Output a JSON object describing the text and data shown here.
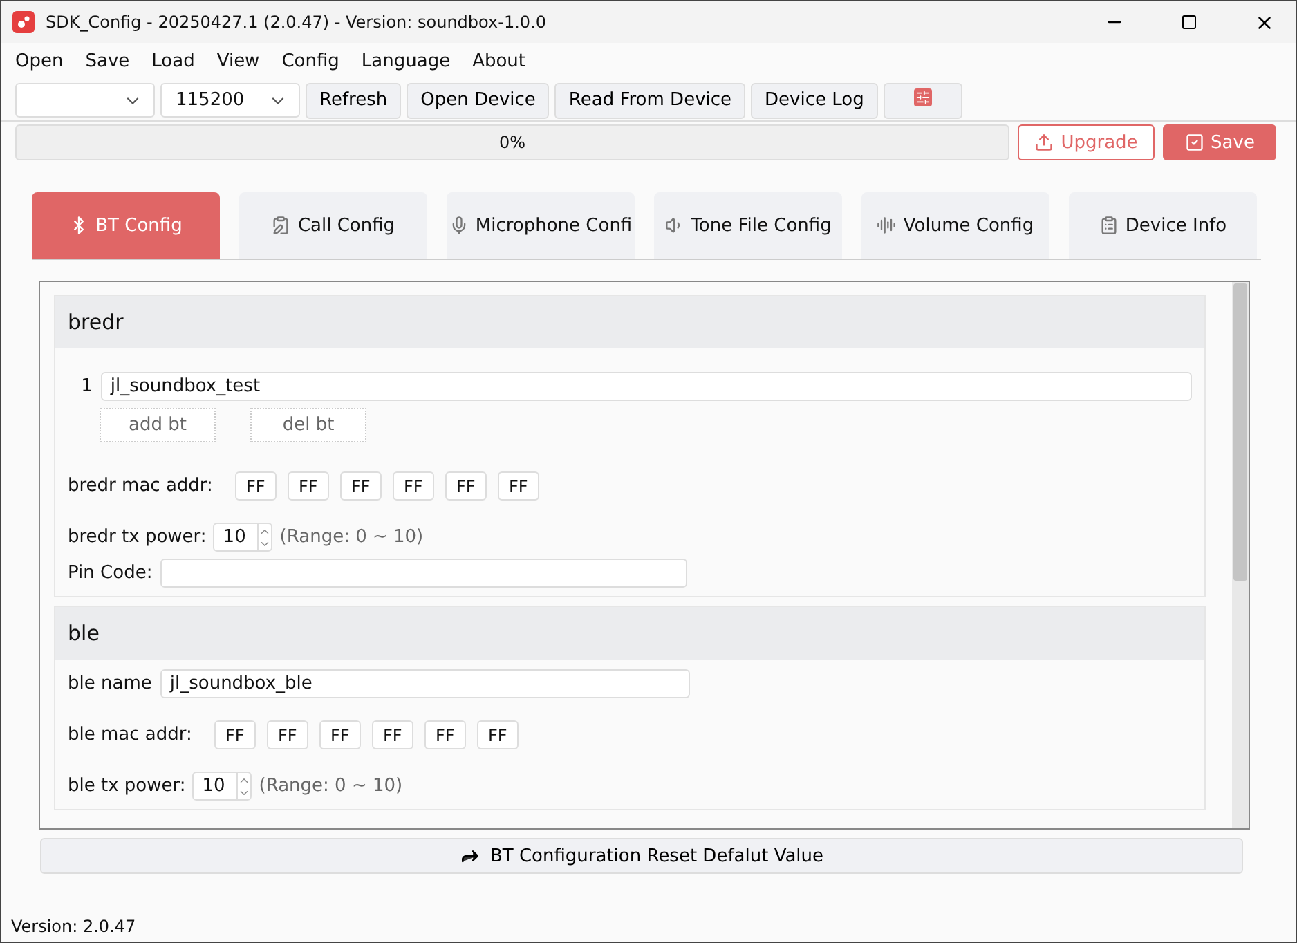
{
  "window": {
    "title": "SDK_Config -  20250427.1  (2.0.47) - Version: soundbox-1.0.0"
  },
  "menu": [
    "Open",
    "Save",
    "Load",
    "View",
    "Config",
    "Language",
    "About"
  ],
  "toolbar": {
    "baud": "115200",
    "buttons": [
      "Refresh",
      "Open Device",
      "Read From Device",
      "Device Log"
    ]
  },
  "progress": {
    "level": 0,
    "reading": "0%"
  },
  "actions": {
    "upgrade": "Upgrade",
    "save": "Save"
  },
  "tabs": [
    {
      "label": "BT Config",
      "selected": true
    },
    {
      "label": "Call Config",
      "selected": false
    },
    {
      "label": "Microphone Confi",
      "selected": false
    },
    {
      "label": "Tone File Config",
      "selected": false
    },
    {
      "label": "Volume Config",
      "selected": false
    },
    {
      "label": "Device Info",
      "selected": false
    }
  ],
  "bredr": {
    "title": "bredr",
    "names": [
      {
        "index": "1",
        "value": "jl_soundbox_test"
      }
    ],
    "add": "add bt",
    "del": "del bt",
    "mac_label": "bredr mac addr:",
    "mac": [
      "FF",
      "FF",
      "FF",
      "FF",
      "FF",
      "FF"
    ],
    "power_label": "bredr tx power:",
    "power": "10",
    "range": "(Range: 0 ~ 10)",
    "pin_label": "Pin Code:"
  },
  "ble": {
    "title": "ble",
    "name_label": "ble name",
    "name": "jl_soundbox_ble",
    "mac_label": "ble mac addr:",
    "mac": [
      "FF",
      "FF",
      "FF",
      "FF",
      "FF",
      "FF"
    ],
    "power_label": "ble tx power:",
    "power": "10",
    "range": "(Range: 0 ~ 10)"
  },
  "reset_button": "BT Configuration Reset Defalut Value",
  "status_bar": "Version: 2.0.47"
}
